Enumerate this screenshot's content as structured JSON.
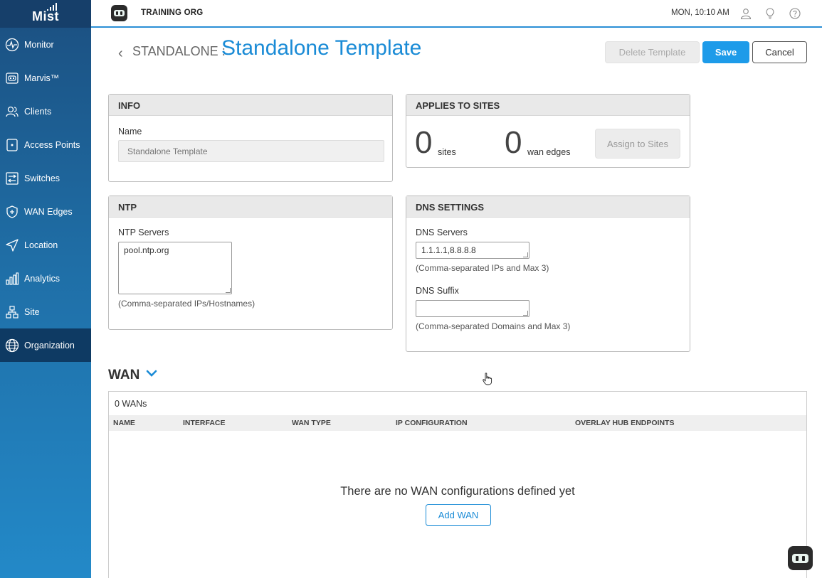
{
  "app": {
    "logo": "Mist"
  },
  "sidebar": {
    "items": [
      {
        "label": "Monitor",
        "icon": "monitor-icon"
      },
      {
        "label": "Marvis™",
        "icon": "marvis-icon"
      },
      {
        "label": "Clients",
        "icon": "clients-icon"
      },
      {
        "label": "Access Points",
        "icon": "access-point-icon"
      },
      {
        "label": "Switches",
        "icon": "switch-icon"
      },
      {
        "label": "WAN Edges",
        "icon": "wan-edge-icon"
      },
      {
        "label": "Location",
        "icon": "location-icon"
      },
      {
        "label": "Analytics",
        "icon": "analytics-icon"
      },
      {
        "label": "Site",
        "icon": "site-icon"
      },
      {
        "label": "Organization",
        "icon": "globe-icon",
        "active": true
      }
    ]
  },
  "header": {
    "org": "TRAINING ORG",
    "clock": "MON, 10:10 AM",
    "icons": [
      "user-icon",
      "lightbulb-icon",
      "help-icon"
    ]
  },
  "page": {
    "crumb": "STANDALONE :",
    "title": "Standalone Template",
    "delete_label": "Delete Template",
    "save_label": "Save",
    "cancel_label": "Cancel"
  },
  "info": {
    "header": "INFO",
    "name_label": "Name",
    "name_placeholder": "Standalone Template"
  },
  "applies": {
    "header": "APPLIES TO SITES",
    "sites_count": "0",
    "sites_unit": "sites",
    "edges_count": "0",
    "edges_unit": "wan edges",
    "assign_label": "Assign to Sites"
  },
  "ntp": {
    "header": "NTP",
    "servers_label": "NTP Servers",
    "servers_value": "pool.ntp.org",
    "hint": "(Comma-separated IPs/Hostnames)"
  },
  "dns": {
    "header": "DNS SETTINGS",
    "servers_label": "DNS Servers",
    "servers_value": "1.1.1.1,8.8.8.8",
    "servers_hint": "(Comma-separated IPs and Max 3)",
    "suffix_label": "DNS Suffix",
    "suffix_value": "",
    "suffix_hint": "(Comma-separated Domains and Max 3)"
  },
  "wan": {
    "title": "WAN",
    "count": "0 WANs",
    "columns": [
      "NAME",
      "INTERFACE",
      "WAN TYPE",
      "IP CONFIGURATION",
      "OVERLAY HUB ENDPOINTS"
    ],
    "empty_message": "There are no WAN configurations defined yet",
    "add_label": "Add WAN"
  },
  "colors": {
    "accent": "#1d9be9",
    "sidebar_top": "#1b4f80",
    "sidebar_bottom": "#2389c8",
    "active_nav": "#0e3a63"
  }
}
